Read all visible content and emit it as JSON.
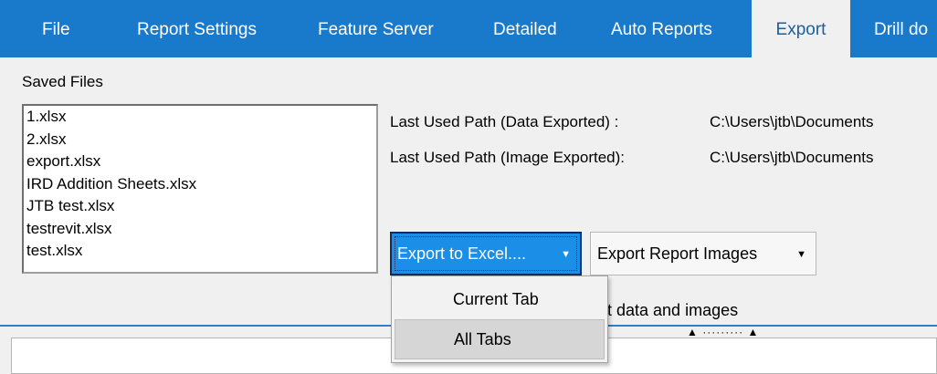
{
  "tabs": [
    {
      "label": "File",
      "active": false
    },
    {
      "label": "Report Settings",
      "active": false
    },
    {
      "label": "Feature Server",
      "active": false
    },
    {
      "label": "Detailed",
      "active": false
    },
    {
      "label": "Auto Reports",
      "active": false
    },
    {
      "label": "Export",
      "active": true
    },
    {
      "label": "Drill do",
      "active": false
    }
  ],
  "saved_files": {
    "label": "Saved Files",
    "items": [
      "1.xlsx",
      "2.xlsx",
      "export.xlsx",
      "IRD Addition Sheets.xlsx",
      "JTB test.xlsx",
      "testrevit.xlsx",
      "test.xlsx"
    ]
  },
  "paths": {
    "data_label": "Last Used Path (Data Exported) :",
    "data_value": "C:\\Users\\jtb\\Documents",
    "image_label": "Last Used Path (Image Exported):",
    "image_value": "C:\\Users\\jtb\\Documents"
  },
  "buttons": {
    "export_excel": "Export to Excel....",
    "export_images": "Export Report Images",
    "caret": "▼"
  },
  "checkbox_text": "t data and images",
  "menu": {
    "items": [
      "Current Tab",
      "All Tabs"
    ],
    "hovered_index": 1
  },
  "colors": {
    "ribbon": "#1979ca",
    "active_button": "#1b8fe7",
    "divider": "#2d7fd0"
  }
}
